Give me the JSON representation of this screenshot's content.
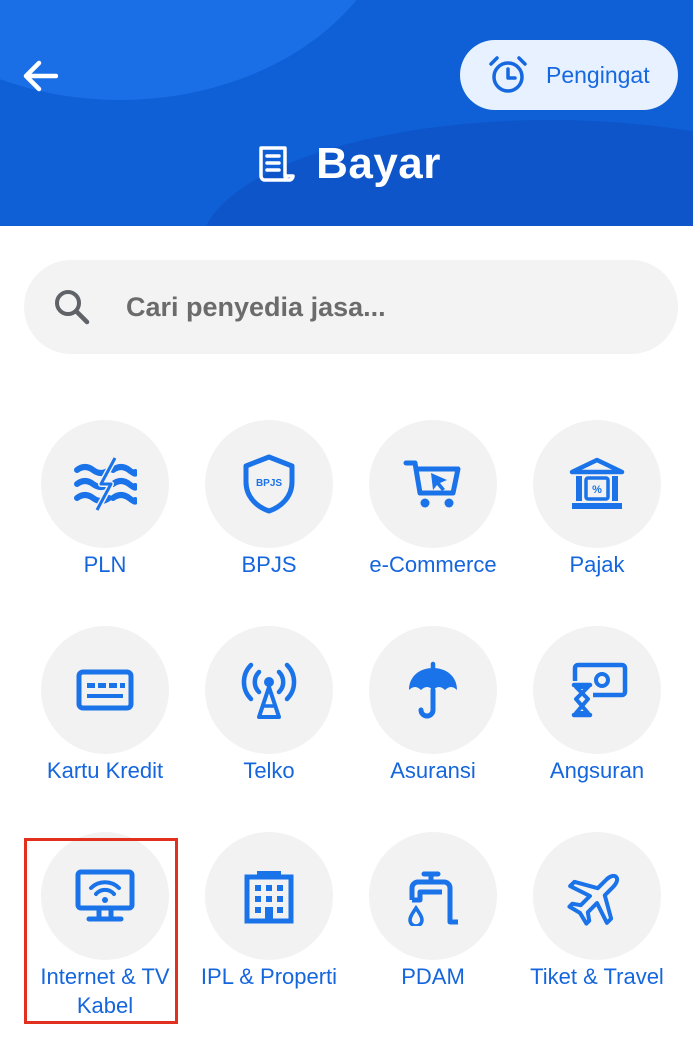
{
  "header": {
    "title": "Bayar",
    "reminder_label": "Pengingat",
    "back_icon": "arrow-left-icon",
    "title_icon": "receipt-icon",
    "reminder_icon": "alarm-clock-icon"
  },
  "search": {
    "placeholder": "Cari penyedia jasa...",
    "value": "",
    "icon": "search-icon"
  },
  "services": [
    {
      "label": "PLN",
      "icon": "electricity-icon"
    },
    {
      "label": "BPJS",
      "icon": "bpjs-shield-icon",
      "badge": "BPJS"
    },
    {
      "label": "e-Commerce",
      "icon": "shopping-cart-icon"
    },
    {
      "label": "Pajak",
      "icon": "tax-building-icon"
    },
    {
      "label": "Kartu Kredit",
      "icon": "credit-card-icon"
    },
    {
      "label": "Telko",
      "icon": "antenna-icon"
    },
    {
      "label": "Asuransi",
      "icon": "umbrella-icon"
    },
    {
      "label": "Angsuran",
      "icon": "installment-icon"
    },
    {
      "label": "Internet & TV Kabel",
      "icon": "wifi-tv-icon"
    },
    {
      "label": "IPL & Properti",
      "icon": "apartment-icon"
    },
    {
      "label": "PDAM",
      "icon": "water-tap-icon"
    },
    {
      "label": "Tiket & Travel",
      "icon": "airplane-icon"
    }
  ],
  "colors": {
    "brand": "#0f5fd6",
    "icon_blue": "#1a73e8",
    "label_blue": "#1566dd",
    "highlight": "#e2301f"
  }
}
